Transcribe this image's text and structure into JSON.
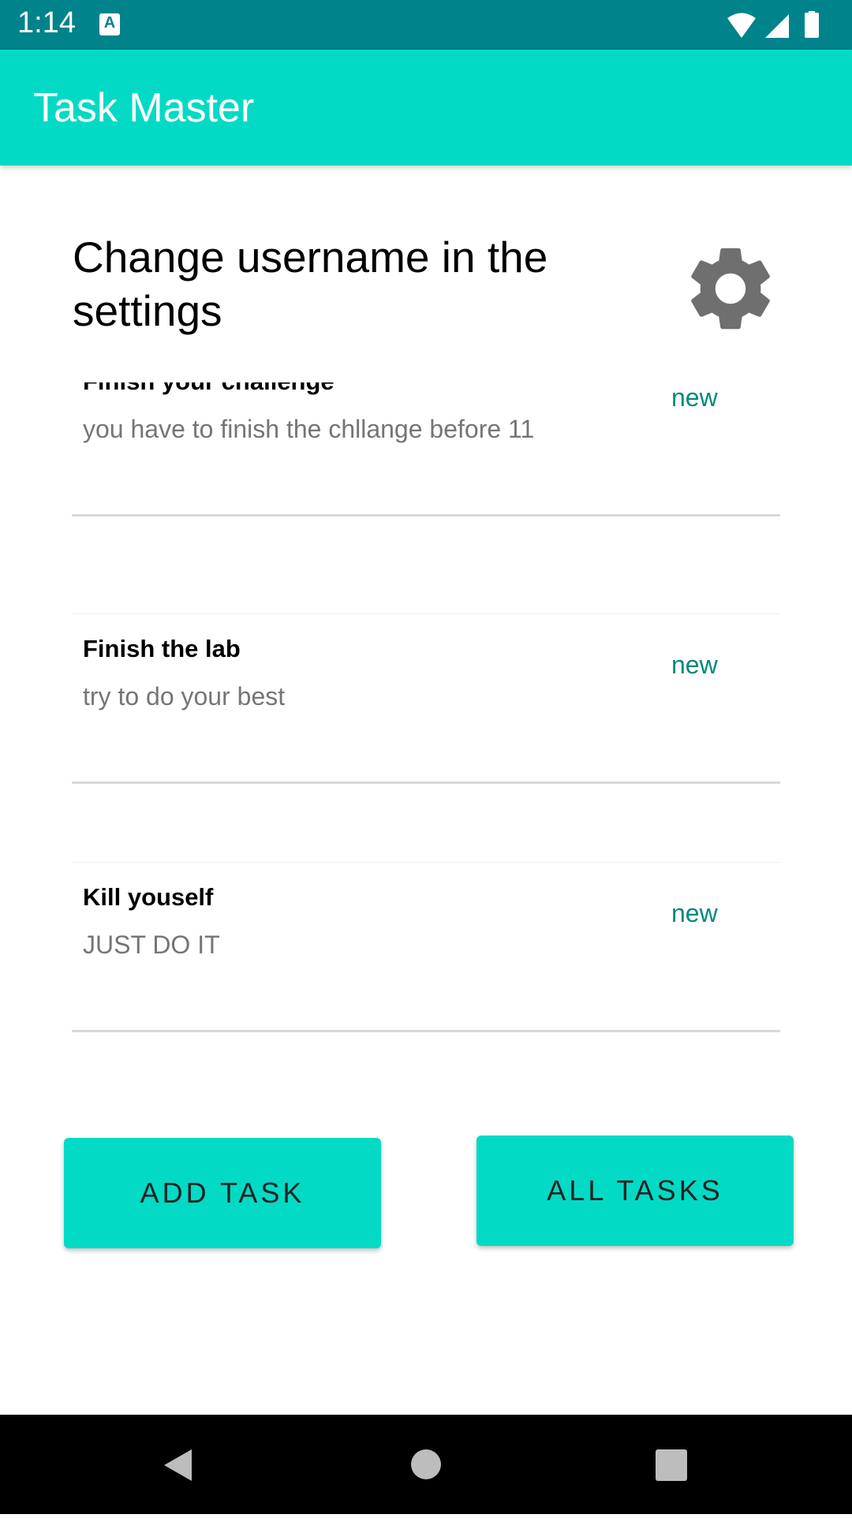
{
  "status_bar": {
    "time": "1:14",
    "icons": [
      "a-notification-icon",
      "wifi-icon",
      "signal-icon",
      "battery-icon"
    ]
  },
  "app_bar": {
    "title": "Task Master"
  },
  "main": {
    "heading": "Change username in the settings",
    "settings_icon": "gear-icon",
    "tasks": [
      {
        "title": "Finish your challenge",
        "body": "you have to finish the chllange before 11",
        "state": "new"
      },
      {
        "title": "Finish the lab",
        "body": "try to do your best",
        "state": "new"
      },
      {
        "title": "Kill youself",
        "body": "JUST DO IT",
        "state": "new"
      }
    ]
  },
  "buttons": {
    "add_task": "ADD TASK",
    "all_tasks": "ALL TASKS"
  },
  "nav_bar": {
    "icons": [
      "back-icon",
      "home-icon",
      "recents-icon"
    ]
  },
  "colors": {
    "status_bar": "#00838a",
    "app_bar": "#03dac5",
    "accent_text": "#00897b"
  }
}
